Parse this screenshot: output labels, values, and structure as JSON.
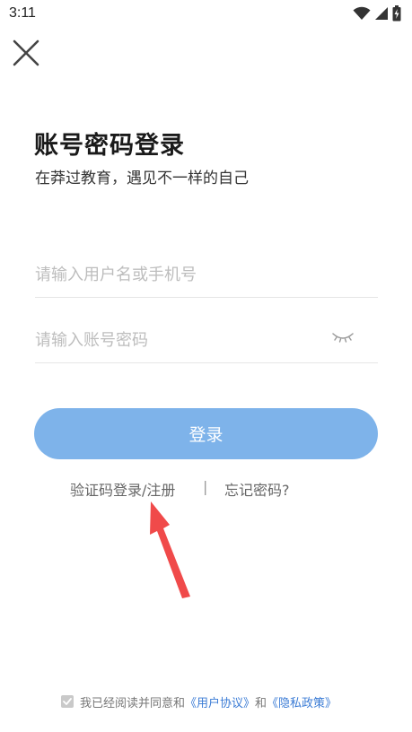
{
  "status": {
    "time": "3:11",
    "icons": [
      "wifi-icon",
      "cellular-signal-icon",
      "battery-charging-icon"
    ]
  },
  "header": {
    "close_icon": "close-icon"
  },
  "title": "账号密码登录",
  "subtitle": "在莽过教育，遇见不一样的自己",
  "form": {
    "username_placeholder": "请输入用户名或手机号",
    "password_placeholder": "请输入账号密码",
    "password_toggle_icon": "eye-closed-icon",
    "login_label": "登录"
  },
  "links": {
    "sms_login": "验证码登录/注册",
    "divider": "|",
    "forgot_password": "忘记密码?"
  },
  "agreement": {
    "prefix": "我已经阅读并同意和",
    "user_agreement": "《用户协议》",
    "and": "和",
    "privacy_policy": "《隐私政策》",
    "checked": true
  },
  "annotation": {
    "arrow_color": "#f04a4a"
  },
  "colors": {
    "primary_button": "#7eb3ea",
    "link": "#3a7bd5"
  }
}
